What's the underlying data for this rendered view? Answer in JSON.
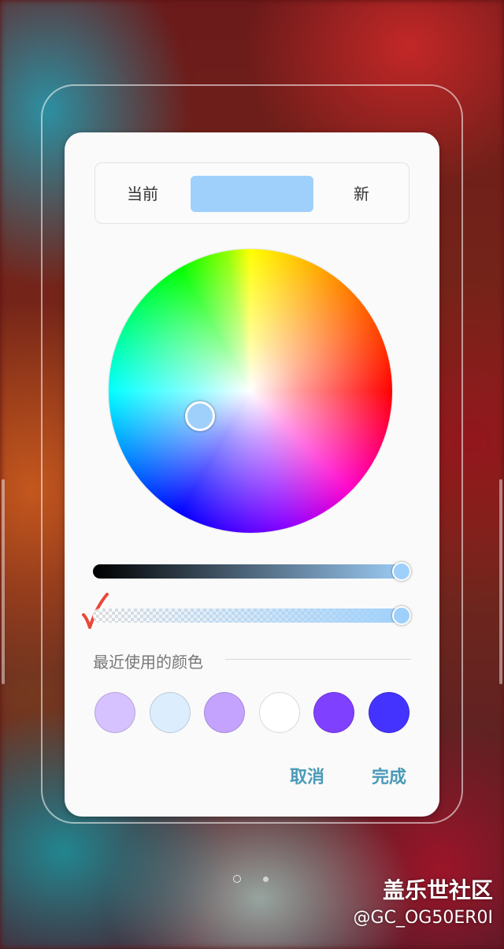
{
  "dialog": {
    "compare": {
      "current_label": "当前",
      "new_label": "新",
      "new_color": "#9fd0fb"
    },
    "wheel_handle_color": "#9fd0fb",
    "brightness_slider": {
      "start_color": "#000000",
      "end_color": "#9fd0fb",
      "value": 1.0
    },
    "alpha_slider": {
      "color": "#9fd0fb",
      "value": 1.0
    },
    "recent": {
      "title": "最近使用的颜色",
      "swatches": [
        "#d6c2ff",
        "#dceefe",
        "#c4a3ff",
        "#ffffff",
        "#8040ff",
        "#4433ff"
      ]
    },
    "buttons": {
      "cancel": "取消",
      "done": "完成"
    }
  },
  "accent_color": "#4a9ab8",
  "watermark": {
    "title": "盖乐世社区",
    "handle": "@GC_OG50ER0I"
  }
}
